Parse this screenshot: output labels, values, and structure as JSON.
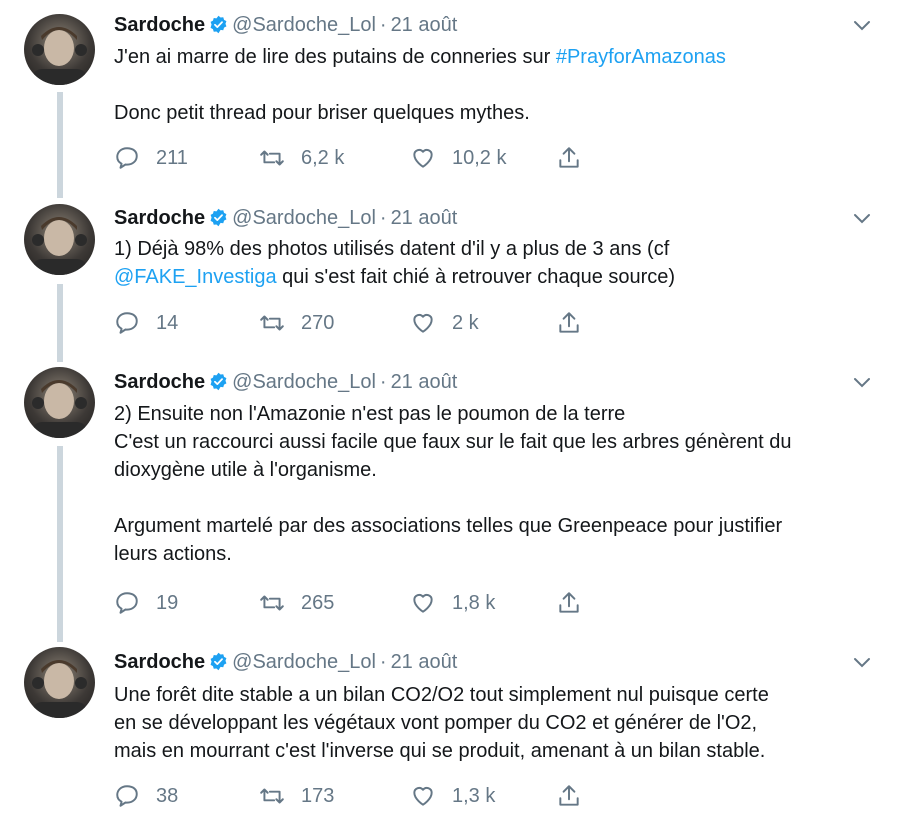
{
  "author": {
    "name": "Sardoche",
    "handle": "@Sardoche_Lol"
  },
  "tweets": [
    {
      "date": "21 août",
      "line1_prefix": "J'en ai marre de lire des putains de conneries sur ",
      "line1_hashtag": "#PrayforAmazonas",
      "line2": "Donc petit thread pour briser quelques mythes.",
      "replies": "211",
      "retweets": "6,2 k",
      "likes": "10,2 k"
    },
    {
      "date": "21 août",
      "line1": "1) Déjà 98% des photos utilisés datent d'il y a plus de 3 ans (cf",
      "line2_mention": "@FAKE_Investiga",
      "line2_rest": " qui s'est fait chié à retrouver chaque source)",
      "replies": "14",
      "retweets": "270",
      "likes": "2 k"
    },
    {
      "date": "21 août",
      "line1": "2) Ensuite non l'Amazonie n'est pas le poumon de la terre",
      "line2": "C'est un raccourci aussi facile que faux sur le fait que les arbres génèrent du",
      "line3": "dioxygène utile à l'organisme.",
      "line4": "Argument martelé par des associations telles que Greenpeace pour justifier",
      "line5": "leurs actions.",
      "replies": "19",
      "retweets": "265",
      "likes": "1,8 k"
    },
    {
      "date": "21 août",
      "line1": "Une forêt dite stable a un bilan CO2/O2 tout simplement nul puisque certe",
      "line2": "en se développant les végétaux vont pomper du CO2 et générer de l'O2,",
      "line3": "mais en mourrant c'est l'inverse qui se produit, amenant à un bilan stable.",
      "replies": "38",
      "retweets": "173",
      "likes": "1,3 k"
    }
  ],
  "separator": "·",
  "colors": {
    "text": "#14171a",
    "muted": "#657786",
    "link": "#1da1f2",
    "thread_line": "#ccd6dd",
    "verified": "#1da1f2"
  },
  "icons": {
    "reply": "speech-bubble-icon",
    "retweet": "retweet-arrows-icon",
    "like": "heart-icon",
    "share": "share-upload-icon",
    "verified": "verified-badge-icon",
    "caret": "chevron-down-icon"
  }
}
